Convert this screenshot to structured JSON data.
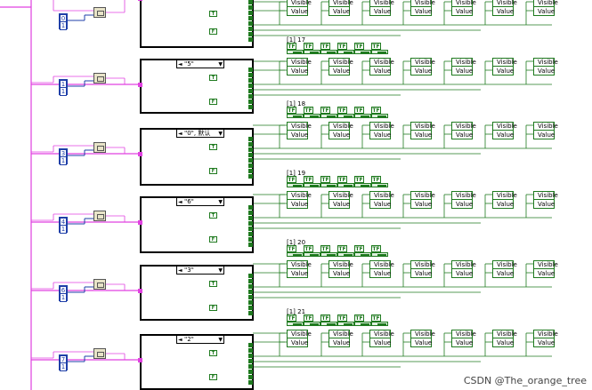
{
  "blocks": [
    {
      "label": "",
      "selector": ""
    },
    {
      "label": "[1] 17",
      "selector": "\"5\""
    },
    {
      "label": "[1] 18",
      "selector": "\"0\", 默认"
    },
    {
      "label": "[1] 19",
      "selector": "\"6\""
    },
    {
      "label": "[1] 20",
      "selector": "\"3\""
    },
    {
      "label": "[1] 21",
      "selector": "\"2\""
    }
  ],
  "array_constants": [
    {
      "a": "0",
      "b": "1"
    },
    {
      "a": "1",
      "b": "1"
    },
    {
      "a": "3",
      "b": "1"
    },
    {
      "a": "4",
      "b": "1"
    },
    {
      "a": "6",
      "b": "1"
    },
    {
      "a": "7",
      "b": "1"
    }
  ],
  "property_labels": {
    "visible": "Visible",
    "value": "Value"
  },
  "tf_label": "TF",
  "bool_true": "T",
  "bool_false": "F",
  "selector_left_arrow": "◄",
  "selector_right_arrow": "▼",
  "watermark": "CSDN @The_orange_tree",
  "colors": {
    "wire_pink": "#e040e0",
    "wire_green": "#1f7a1f",
    "wire_blue": "#1f3fa8"
  }
}
